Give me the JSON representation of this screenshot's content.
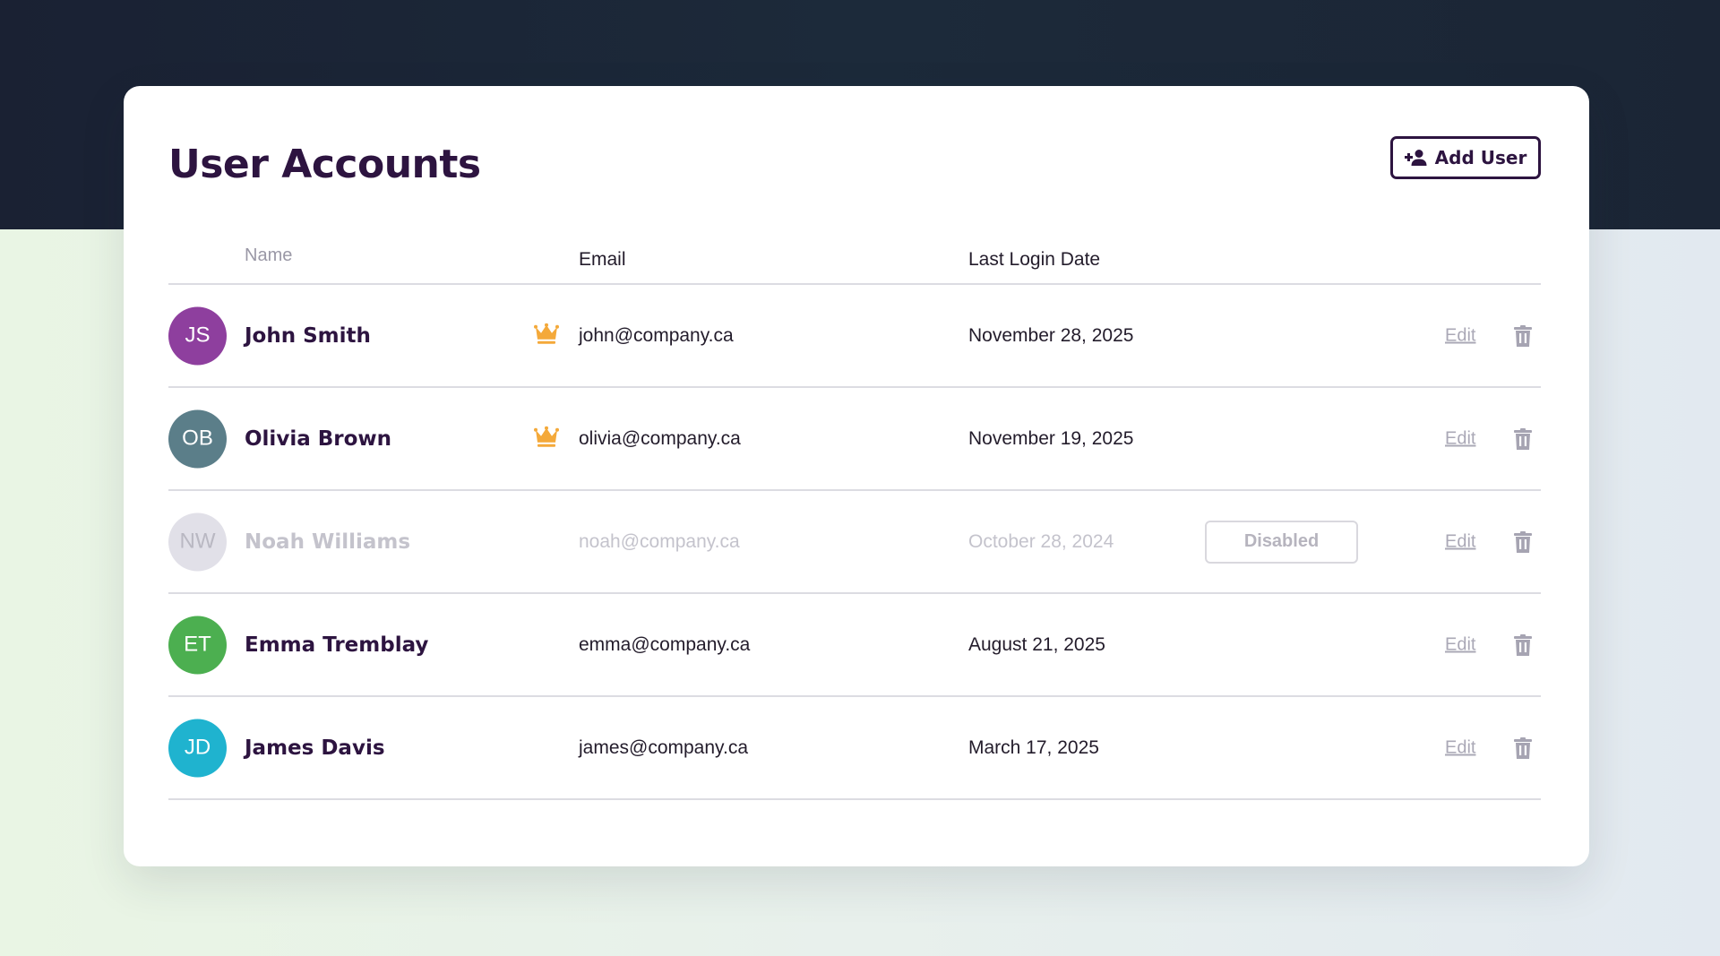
{
  "header": {
    "title": "User Accounts",
    "add_user_label": "Add User"
  },
  "table": {
    "columns": {
      "name": "Name",
      "email": "Email",
      "last_login": "Last Login Date"
    },
    "rows": [
      {
        "initials": "JS",
        "name": "John Smith",
        "email": "john@company.ca",
        "last_login": "November 28, 2025",
        "admin": true,
        "status": "",
        "edit_label": "Edit",
        "avatar_color": "#8e3f9e",
        "disabled": false
      },
      {
        "initials": "OB",
        "name": "Olivia Brown",
        "email": "olivia@company.ca",
        "last_login": "November 19, 2025",
        "admin": true,
        "status": "",
        "edit_label": "Edit",
        "avatar_color": "#5b7e89",
        "disabled": false
      },
      {
        "initials": "NW",
        "name": "Noah Williams",
        "email": "noah@company.ca",
        "last_login": "October 28, 2024",
        "admin": false,
        "status": "Disabled",
        "edit_label": "Edit",
        "avatar_color": "#e1e0e8",
        "disabled": true
      },
      {
        "initials": "ET",
        "name": "Emma Tremblay",
        "email": "emma@company.ca",
        "last_login": "August 21, 2025",
        "admin": false,
        "status": "",
        "edit_label": "Edit",
        "avatar_color": "#4caf50",
        "disabled": false
      },
      {
        "initials": "JD",
        "name": "James Davis",
        "email": "james@company.ca",
        "last_login": "March 17, 2025",
        "admin": false,
        "status": "",
        "edit_label": "Edit",
        "avatar_color": "#1fb3cf",
        "disabled": false
      }
    ]
  },
  "icons": {
    "add_user": "person-add-icon",
    "admin": "crown-icon",
    "delete": "trash-icon"
  },
  "colors": {
    "title": "#2d1440",
    "crown": "#f4a93a",
    "muted": "#aaa8b6"
  }
}
